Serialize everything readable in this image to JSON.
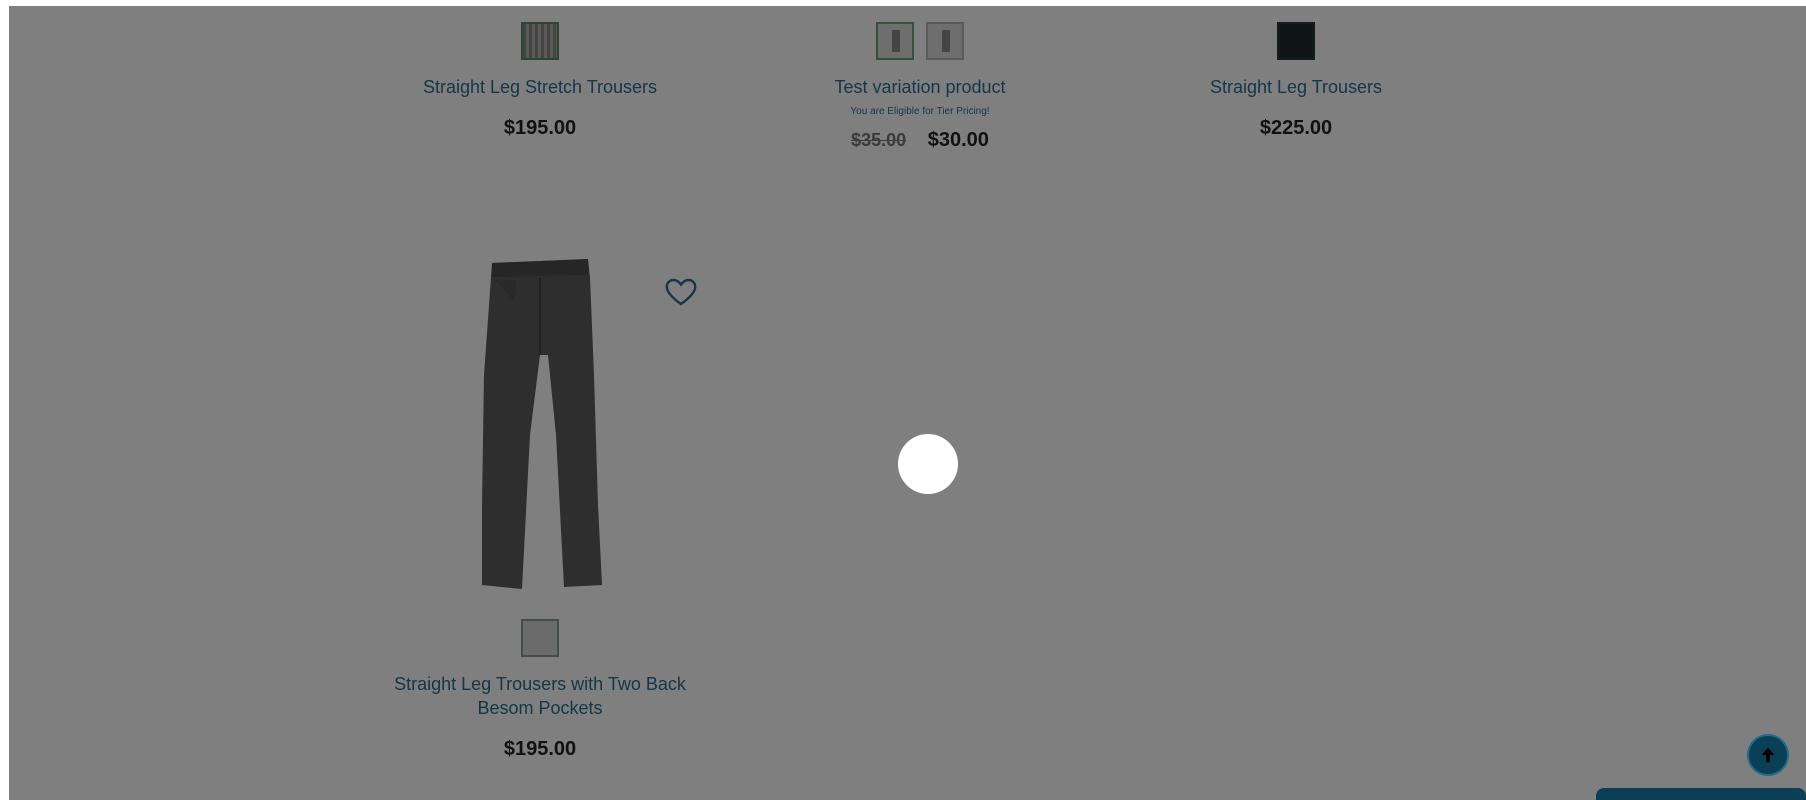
{
  "products": [
    {
      "name": "Straight Leg Stretch Trousers",
      "price": "$195.00",
      "swatch": "striped"
    },
    {
      "name": "Test variation product",
      "tier_note": "You are Eligible for Tier Pricing!",
      "old_price": "$35.00",
      "price": "$30.00"
    },
    {
      "name": "Straight Leg Trousers",
      "price": "$225.00",
      "swatch": "dark"
    },
    {
      "name_line1": "Straight Leg Trousers with Two Back",
      "name_line2": "Besom Pockets",
      "price": "$195.00",
      "image": "grey-trousers-image",
      "wishlist_icon": "heart-outline-icon"
    }
  ],
  "overlay": {
    "loading_indicator": "loading-spinner-icon",
    "dim_color": "#000000"
  },
  "controls": {
    "scroll_top_icon": "arrow-up-icon",
    "accent_color": "#0b3f55"
  }
}
